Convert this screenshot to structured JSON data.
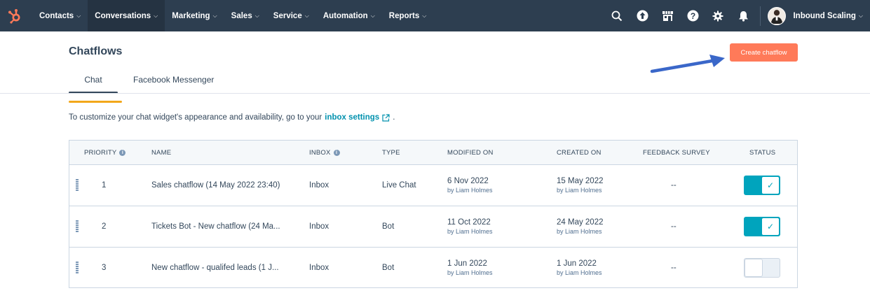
{
  "nav": {
    "items": [
      {
        "label": "Contacts",
        "active": false
      },
      {
        "label": "Conversations",
        "active": true
      },
      {
        "label": "Marketing",
        "active": false
      },
      {
        "label": "Sales",
        "active": false
      },
      {
        "label": "Service",
        "active": false
      },
      {
        "label": "Automation",
        "active": false
      },
      {
        "label": "Reports",
        "active": false
      }
    ],
    "caret": "⌵",
    "icons": [
      "search-icon",
      "upgrade-icon",
      "marketplace-icon",
      "help-icon",
      "settings-icon",
      "notifications-icon"
    ],
    "account_name": "Inbound Scaling"
  },
  "page": {
    "title": "Chatflows",
    "create_button": "Create chatflow"
  },
  "tabs": [
    {
      "label": "Chat",
      "active": true
    },
    {
      "label": "Facebook Messenger",
      "active": false
    }
  ],
  "info": {
    "text": "To customize your chat widget's appearance and availability, go to your",
    "link": "inbox settings",
    "end": "."
  },
  "table": {
    "headers": {
      "priority": "PRIORITY",
      "name": "NAME",
      "inbox": "INBOX",
      "type": "TYPE",
      "modified": "MODIFIED ON",
      "created": "CREATED ON",
      "feedback": "FEEDBACK SURVEY",
      "status": "STATUS"
    },
    "rows": [
      {
        "priority": "1",
        "name": "Sales chatflow (14 May 2022 23:40)",
        "inbox": "Inbox",
        "type": "Live Chat",
        "modified": "6 Nov 2022",
        "modified_by": "by Liam Holmes",
        "created": "15 May 2022",
        "created_by": "by Liam Holmes",
        "feedback": "--",
        "status_on": true
      },
      {
        "priority": "2",
        "name": "Tickets Bot - New chatflow (24 Ma...",
        "inbox": "Inbox",
        "type": "Bot",
        "modified": "11 Oct 2022",
        "modified_by": "by Liam Holmes",
        "created": "24 May 2022",
        "created_by": "by Liam Holmes",
        "feedback": "--",
        "status_on": true
      },
      {
        "priority": "3",
        "name": "New chatflow - qualifed leads (1 J...",
        "inbox": "Inbox",
        "type": "Bot",
        "modified": "1 Jun 2022",
        "modified_by": "by Liam Holmes",
        "created": "1 Jun 2022",
        "created_by": "by Liam Holmes",
        "feedback": "--",
        "status_on": false
      }
    ]
  },
  "colors": {
    "nav_bg": "#2d3e50",
    "accent_orange": "#ff7a59",
    "toggle_on": "#00a4bd",
    "link": "#0091ae",
    "annotation_arrow": "#3a67c9",
    "annotation_underline": "#f2a71b"
  }
}
